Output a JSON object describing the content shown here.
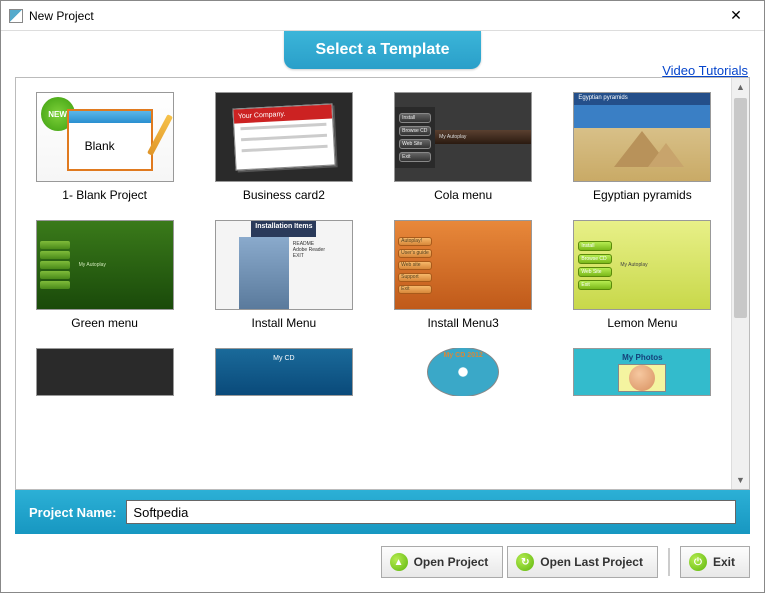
{
  "window": {
    "title": "New Project"
  },
  "header": {
    "tab_label": "Select a Template",
    "tutorials_link": "Video Tutorials"
  },
  "templates": [
    {
      "label": "1- Blank Project",
      "badge": "NEW",
      "blank_text": "Blank"
    },
    {
      "label": "Business card2",
      "card_header": "Your Company."
    },
    {
      "label": "Cola menu",
      "buttons": [
        "Install",
        "Browse CD",
        "Web Site",
        "Exit"
      ],
      "brand": "My Autoplay"
    },
    {
      "label": "Egyptian pyramids",
      "title_text": "Egyptian pyramids"
    },
    {
      "label": "Green menu",
      "brand": "My Autoplay"
    },
    {
      "label": "Install Menu",
      "header": "Installation Items"
    },
    {
      "label": "Install Menu3",
      "buttons": [
        "Autoplay!",
        "User's guide",
        "Web site",
        "Support",
        "Exit"
      ],
      "brand": "My Autoplay"
    },
    {
      "label": "Lemon Menu",
      "buttons": [
        "Install",
        "Browse CD",
        "Web Site",
        "Exit"
      ],
      "brand": "My Autoplay"
    },
    {
      "label": "",
      "partial": true
    },
    {
      "label": "",
      "partial": true,
      "title_text": "My CD"
    },
    {
      "label": "",
      "partial": true,
      "disc_text": "My CD 2012"
    },
    {
      "label": "",
      "partial": true,
      "title_text": "My Photos"
    }
  ],
  "footer": {
    "label": "Project Name:",
    "value": "Softpedia"
  },
  "buttons": {
    "open_project": "Open Project",
    "open_last": "Open Last Project",
    "exit": "Exit"
  }
}
